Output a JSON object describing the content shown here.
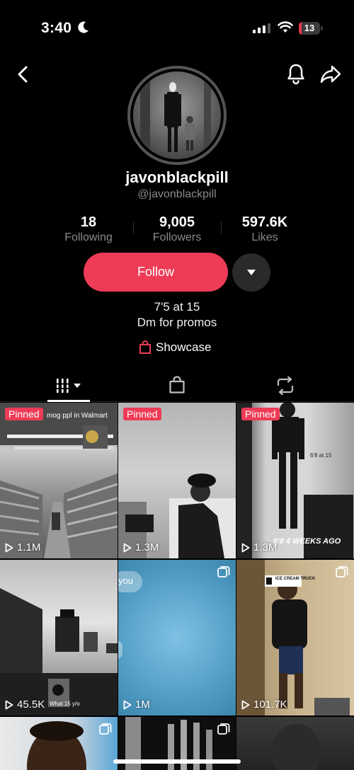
{
  "status_bar": {
    "time": "3:40",
    "battery_level": "13",
    "battery_color": "#e8374a"
  },
  "profile": {
    "username": "javonblackpill",
    "handle": "@javonblackpill",
    "stats": [
      {
        "value": "18",
        "label": "Following"
      },
      {
        "value": "9,005",
        "label": "Followers"
      },
      {
        "value": "597.6K",
        "label": "Likes"
      }
    ],
    "follow_label": "Follow",
    "bio_lines": [
      "7'5 at 15",
      "Dm for promos"
    ],
    "showcase_label": "Showcase",
    "accent_color": "#ee3b56"
  },
  "tabs": [
    {
      "name": "videos-tab",
      "icon": "grid-icon",
      "active": true
    },
    {
      "name": "shop-tab",
      "icon": "shopping-bag-icon",
      "active": false
    },
    {
      "name": "reposts-tab",
      "icon": "repost-icon",
      "active": false
    }
  ],
  "videos": [
    {
      "pinned_label": "Pinned",
      "views": "1.1M",
      "caption": "mog ppl in Walmart"
    },
    {
      "pinned_label": "Pinned",
      "views": "1.3M",
      "caption": ""
    },
    {
      "pinned_label": "Pinned",
      "views": "1.3M",
      "caption": "6'8 4 WEEKS AGO",
      "caption2": "6'8 at 15"
    },
    {
      "views": "45.5K",
      "caption": "What 15 y/o"
    },
    {
      "views": "1M",
      "caption": "you"
    },
    {
      "views": "101.7K",
      "caption": "ICE CREAM TRUCK"
    },
    {
      "views": ""
    },
    {
      "views": ""
    },
    {
      "views": ""
    }
  ]
}
